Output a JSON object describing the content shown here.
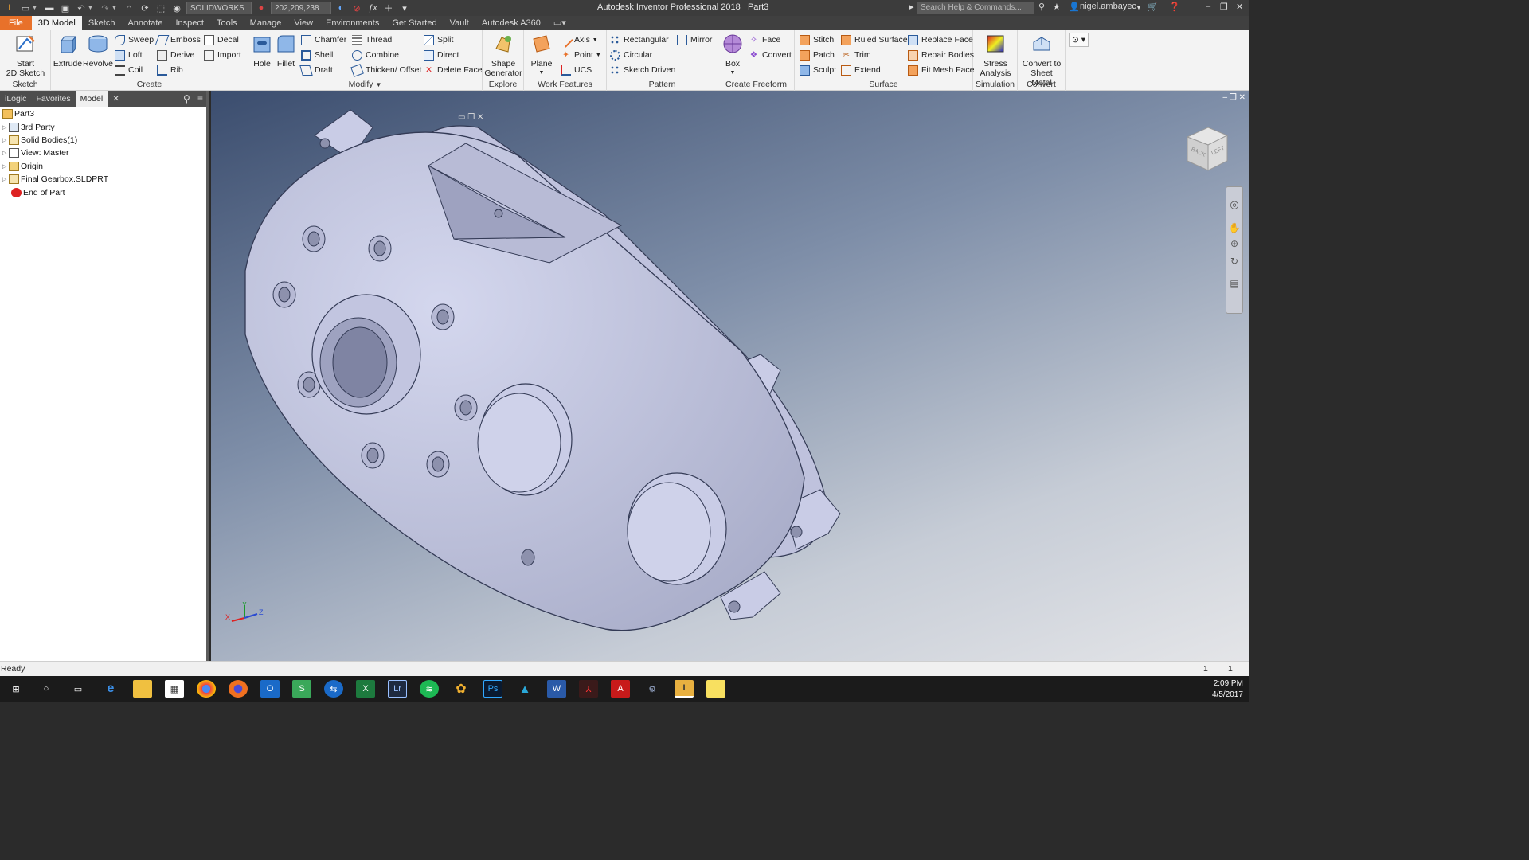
{
  "titlebar": {
    "app_title": "Autodesk Inventor Professional 2018",
    "doc_name": "Part3",
    "appearance_combo": "SOLIDWORKS",
    "color_combo": "202,209,238",
    "search_placeholder": "Search Help & Commands...",
    "user": "nigel.ambayec"
  },
  "ribbon_tabs": [
    "File",
    "3D Model",
    "Sketch",
    "Annotate",
    "Inspect",
    "Tools",
    "Manage",
    "View",
    "Environments",
    "Get Started",
    "Vault",
    "Autodesk A360"
  ],
  "active_tab": "3D Model",
  "ribbon": {
    "sketch": {
      "label": "Sketch",
      "start_line1": "Start",
      "start_line2": "2D Sketch"
    },
    "create": {
      "label": "Create",
      "extrude": "Extrude",
      "revolve": "Revolve",
      "sweep": "Sweep",
      "loft": "Loft",
      "coil": "Coil",
      "emboss": "Emboss",
      "derive": "Derive",
      "rib": "Rib",
      "decal": "Decal",
      "import": "Import"
    },
    "modify": {
      "label": "Modify",
      "hole": "Hole",
      "fillet": "Fillet",
      "chamfer": "Chamfer",
      "shell": "Shell",
      "draft": "Draft",
      "thread": "Thread",
      "combine": "Combine",
      "thicken": "Thicken/ Offset",
      "split": "Split",
      "direct": "Direct",
      "delete_face": "Delete Face"
    },
    "explore": {
      "label": "Explore",
      "shape_line1": "Shape",
      "shape_line2": "Generator"
    },
    "work_features": {
      "label": "Work Features",
      "plane": "Plane",
      "axis": "Axis",
      "point": "Point",
      "ucs": "UCS"
    },
    "pattern": {
      "label": "Pattern",
      "rectangular": "Rectangular",
      "circular": "Circular",
      "sketch_driven": "Sketch Driven",
      "mirror": "Mirror"
    },
    "freeform": {
      "label": "Create Freeform",
      "box": "Box",
      "face": "Face",
      "convert": "Convert"
    },
    "surface": {
      "label": "Surface",
      "stitch": "Stitch",
      "patch": "Patch",
      "sculpt": "Sculpt",
      "ruled_surface": "Ruled Surface",
      "trim": "Trim",
      "extend": "Extend",
      "replace_face": "Replace Face",
      "repair_bodies": "Repair Bodies",
      "fit_mesh_face": "Fit Mesh Face"
    },
    "simulation": {
      "label": "Simulation",
      "stress_line1": "Stress",
      "stress_line2": "Analysis"
    },
    "convert": {
      "label": "Convert",
      "sheet_line1": "Convert to",
      "sheet_line2": "Sheet Metal"
    }
  },
  "browser": {
    "tabs": [
      "iLogic",
      "Favorites",
      "Model"
    ],
    "tree": [
      "Part3",
      "3rd Party",
      "Solid Bodies(1)",
      "View: Master",
      "Origin",
      "Final Gearbox.SLDPRT",
      "End of Part"
    ]
  },
  "viewcube": {
    "face_back": "BACK",
    "face_left": "LEFT"
  },
  "triad": {
    "x": "X",
    "y": "Y",
    "z": "Z"
  },
  "status": {
    "text": "Ready",
    "count1": "1",
    "count2": "1"
  },
  "taskbar": {
    "time": "2:09 PM",
    "date": "4/5/2017"
  },
  "colors": {
    "file_tab": "#e8712a",
    "model_fill": "#c9cce6",
    "viewport_top": "#3b4d6e"
  }
}
